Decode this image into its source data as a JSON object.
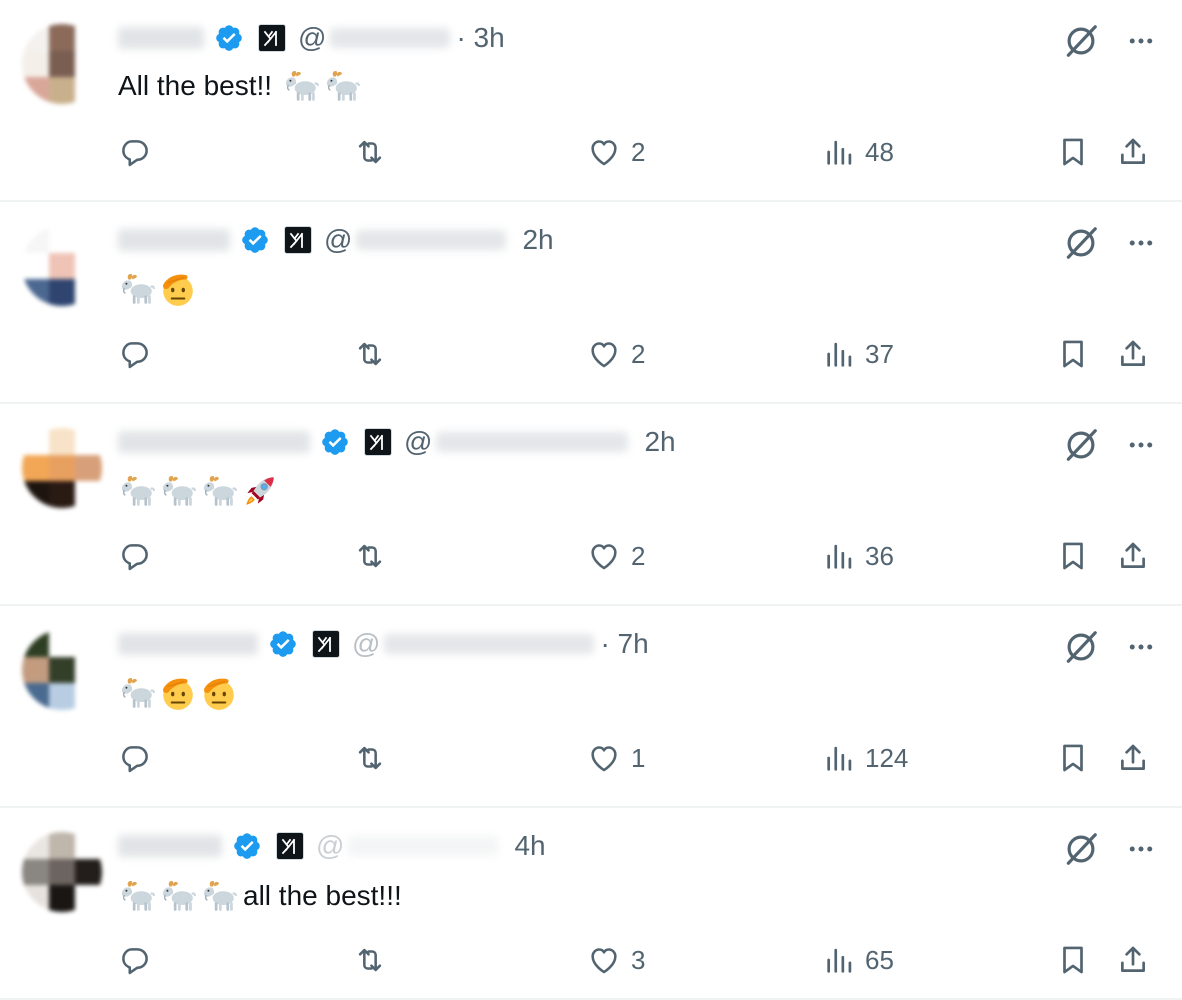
{
  "icons": {
    "verified": "verified-badge-icon",
    "affiliate": "xai-affiliate-badge-icon",
    "grok": "grok-icon",
    "more": "more-options-icon",
    "reply": "reply-icon",
    "retweet": "retweet-icon",
    "like": "heart-icon",
    "views": "views-icon",
    "bookmark": "bookmark-icon",
    "share": "share-icon"
  },
  "colors": {
    "verified_blue": "#1d9bf0",
    "secondary_text": "#536471",
    "primary_text": "#0f1419",
    "divider": "#eff3f4"
  },
  "tweets": [
    {
      "handle_prefix": "@",
      "time": "· 3h",
      "text": "All the best!!",
      "emojis": [
        "goat",
        "goat"
      ],
      "text_first": true,
      "reply_count": "",
      "retweet_count": "",
      "like_count": "2",
      "view_count": "48"
    },
    {
      "handle_prefix": "@",
      "time": "2h",
      "text": "",
      "emojis": [
        "goat",
        "saluting-face"
      ],
      "text_first": false,
      "reply_count": "",
      "retweet_count": "",
      "like_count": "2",
      "view_count": "37"
    },
    {
      "handle_prefix": "@",
      "time": "2h",
      "text": "",
      "emojis": [
        "goat",
        "goat",
        "goat",
        "rocket"
      ],
      "text_first": false,
      "reply_count": "",
      "retweet_count": "",
      "like_count": "2",
      "view_count": "36"
    },
    {
      "handle_prefix": "@",
      "time": "· 7h",
      "text": "",
      "emojis": [
        "goat",
        "saluting-face",
        "saluting-face"
      ],
      "text_first": false,
      "reply_count": "",
      "retweet_count": "",
      "like_count": "1",
      "view_count": "124"
    },
    {
      "handle_prefix": "@",
      "time": "4h",
      "text": "all the best!!!",
      "emojis": [
        "goat",
        "goat",
        "goat"
      ],
      "text_first": false,
      "reply_count": "",
      "retweet_count": "",
      "like_count": "3",
      "view_count": "65"
    }
  ]
}
